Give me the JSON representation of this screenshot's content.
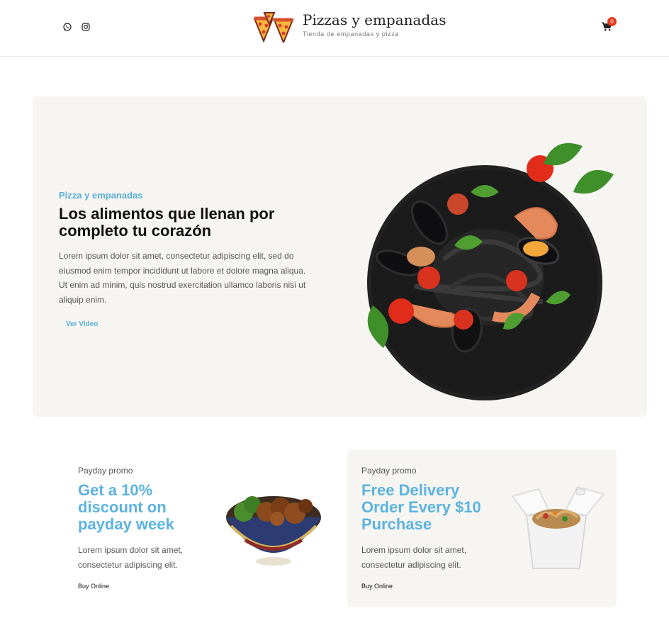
{
  "header": {
    "icons": {
      "whatsapp": "whatsapp-icon",
      "instagram": "instagram-icon",
      "cart": "cart-icon"
    },
    "brand_title": "Pizzas y empanadas",
    "brand_subtitle": "Tienda de empanadas y pizza",
    "cart_count": "0"
  },
  "hero": {
    "kicker": "Pizza y empanadas",
    "title": "Los alimentos que llenan por completo tu corazón",
    "text": "Lorem ipsum dolor sit amet, consectetur adipiscing elit, sed do eiusmod enim tempor incididunt ut labore et dolore magna aliqua. Ut enim ad minim, quis nostrud exercitation ullamco laboris nisi ut aliquip enim.",
    "link": "Ver Video"
  },
  "promos": [
    {
      "kicker": "Payday promo",
      "title": "Get a 10% discount on payday week",
      "text": "Lorem ipsum dolor sit amet, consectetur adipiscing elit.",
      "link": "Buy Online"
    },
    {
      "kicker": "Payday promo",
      "title": "Free Delivery Order Every $10 Purchase",
      "text": "Lorem ipsum dolor sit amet, consectetur adipiscing elit.",
      "link": "Buy Online"
    }
  ],
  "colors": {
    "accent": "#5aaed6",
    "badge": "#e53b1d",
    "panel": "#f6f5f2"
  }
}
